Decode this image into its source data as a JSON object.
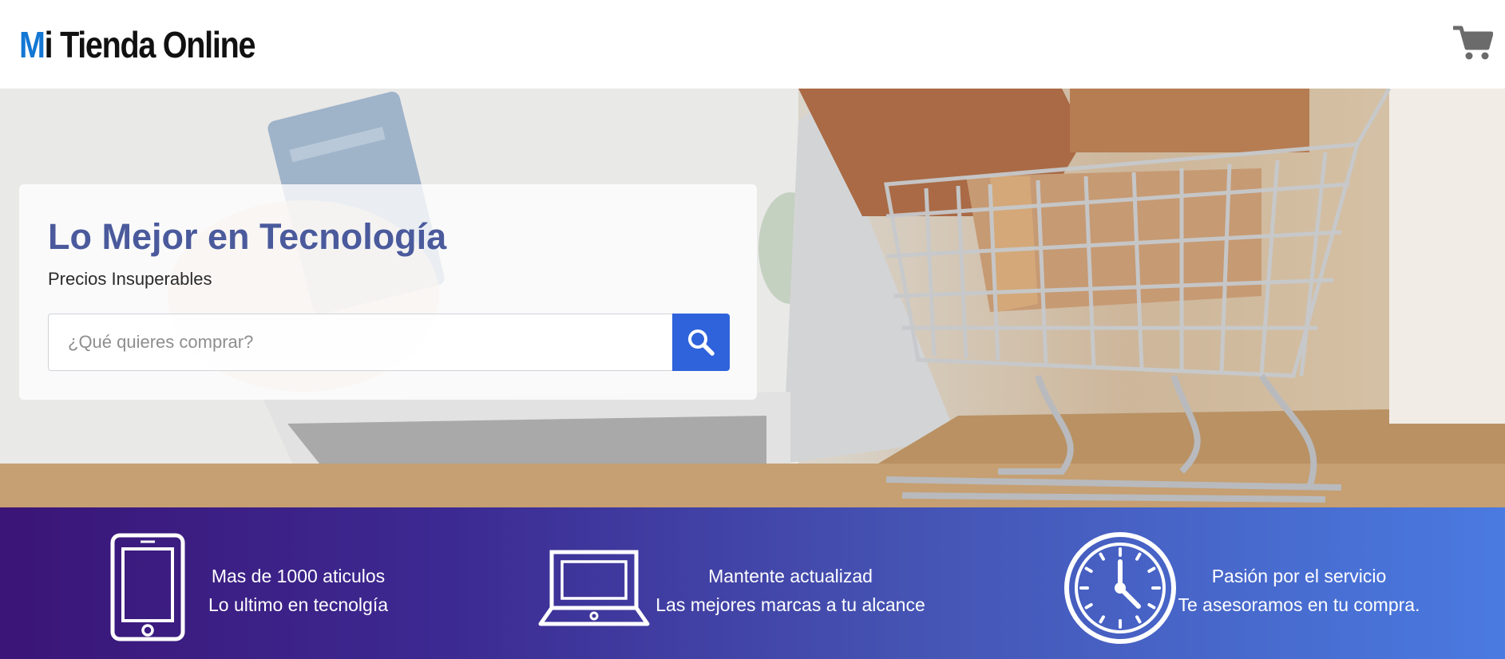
{
  "brand": {
    "name_accent": "M",
    "name_rest": "i Tienda Online"
  },
  "header": {
    "cart_icon": "shopping-cart-icon"
  },
  "hero": {
    "title": "Lo Mejor en Tecnología",
    "subtitle": "Precios Insuperables",
    "search": {
      "placeholder": "¿Qué quieres comprar?",
      "value": "",
      "button_icon": "search-icon"
    }
  },
  "features": [
    {
      "icon": "smartphone-icon",
      "line1": "Mas de 1000 aticulos",
      "line2": "Lo ultimo en tecnolgía"
    },
    {
      "icon": "laptop-icon",
      "line1": "Mantente actualizad",
      "line2": "Las mejores marcas a tu alcance"
    },
    {
      "icon": "clock-icon",
      "line1": "Pasión por el servicio",
      "line2": "Te asesoramos en tu compra."
    }
  ],
  "colors": {
    "brand_accent": "#1377d4",
    "title": "#4a5a9c",
    "search_button": "#2f63db",
    "band_start": "#3b1577",
    "band_end": "#4a7ae0"
  }
}
